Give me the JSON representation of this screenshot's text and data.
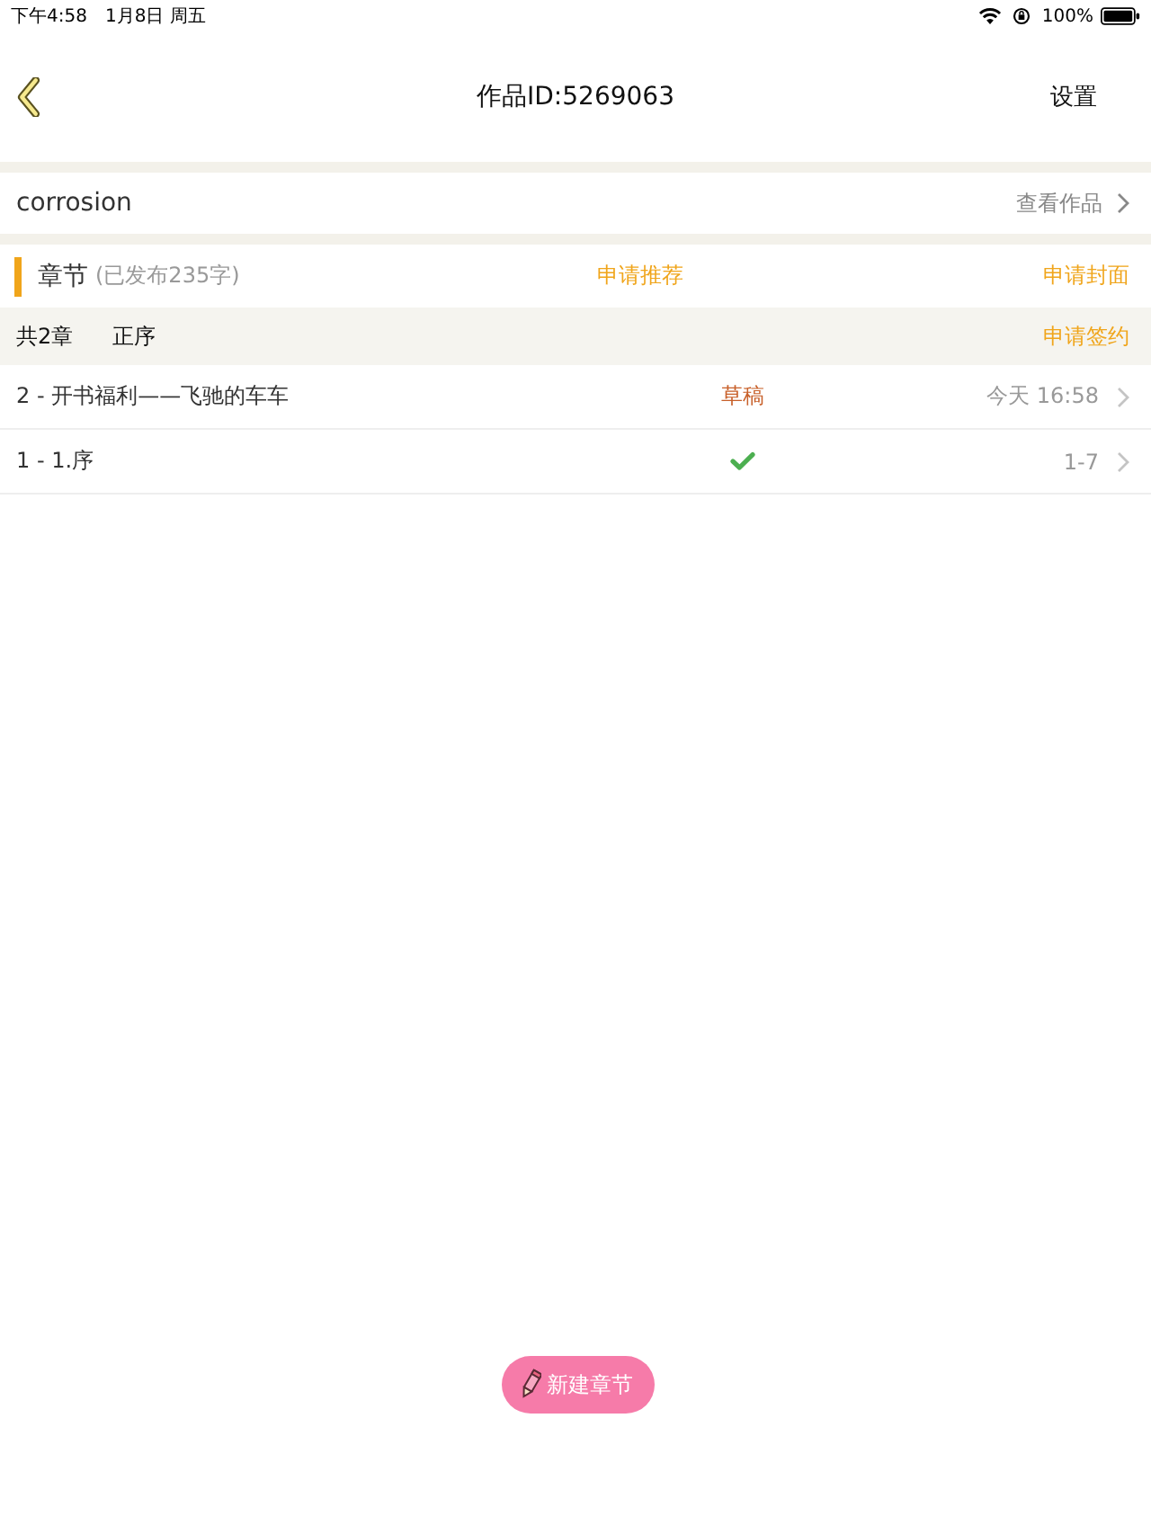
{
  "status_bar": {
    "time": "下午4:58",
    "date": "1月8日 周五",
    "battery": "100%"
  },
  "nav_bar": {
    "title": "作品ID:5269063",
    "right_button": "设置"
  },
  "work_row": {
    "title": "corrosion",
    "link": "查看作品"
  },
  "chapter_header": {
    "title": "章节",
    "subtitle": "(已发布235字)",
    "actions": [
      "申请推荐",
      "申请封面"
    ]
  },
  "list_toolbar": {
    "count": "共2章",
    "sort": "正序",
    "action": "申请签约"
  },
  "chapters": [
    {
      "title": "2 - 开书福利——飞驰的车车",
      "kind": "draft",
      "status": "草稿",
      "time": "今天 16:58"
    },
    {
      "title": "1 - 1.序",
      "kind": "published",
      "time": "1-7"
    }
  ],
  "new_chapter_button": "新建章节"
}
